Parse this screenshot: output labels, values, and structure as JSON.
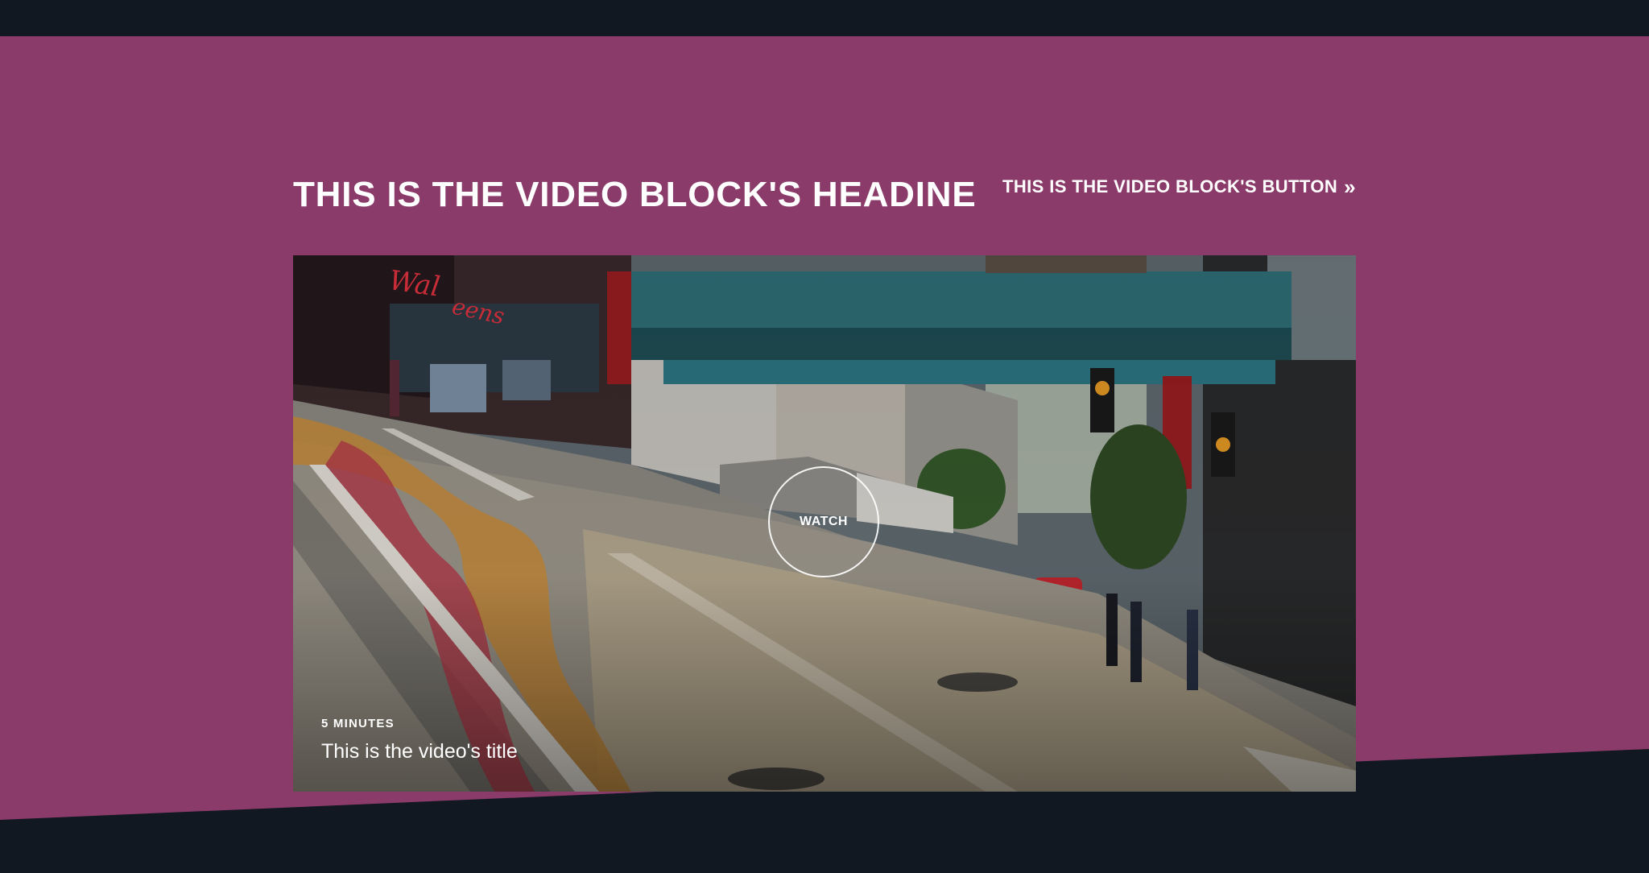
{
  "block": {
    "headline": "THIS IS THE VIDEO BLOCK'S HEADINE",
    "button_label": "THIS IS THE VIDEO BLOCK'S BUTTON",
    "button_icon": "double-chevron-right-icon",
    "button_glyph": "»"
  },
  "video": {
    "watch_label": "WATCH",
    "duration": "5 MINUTES",
    "title": "This is the video's title"
  },
  "colors": {
    "band": "#8b3b69",
    "dark": "#111822",
    "text": "#ffffff"
  }
}
